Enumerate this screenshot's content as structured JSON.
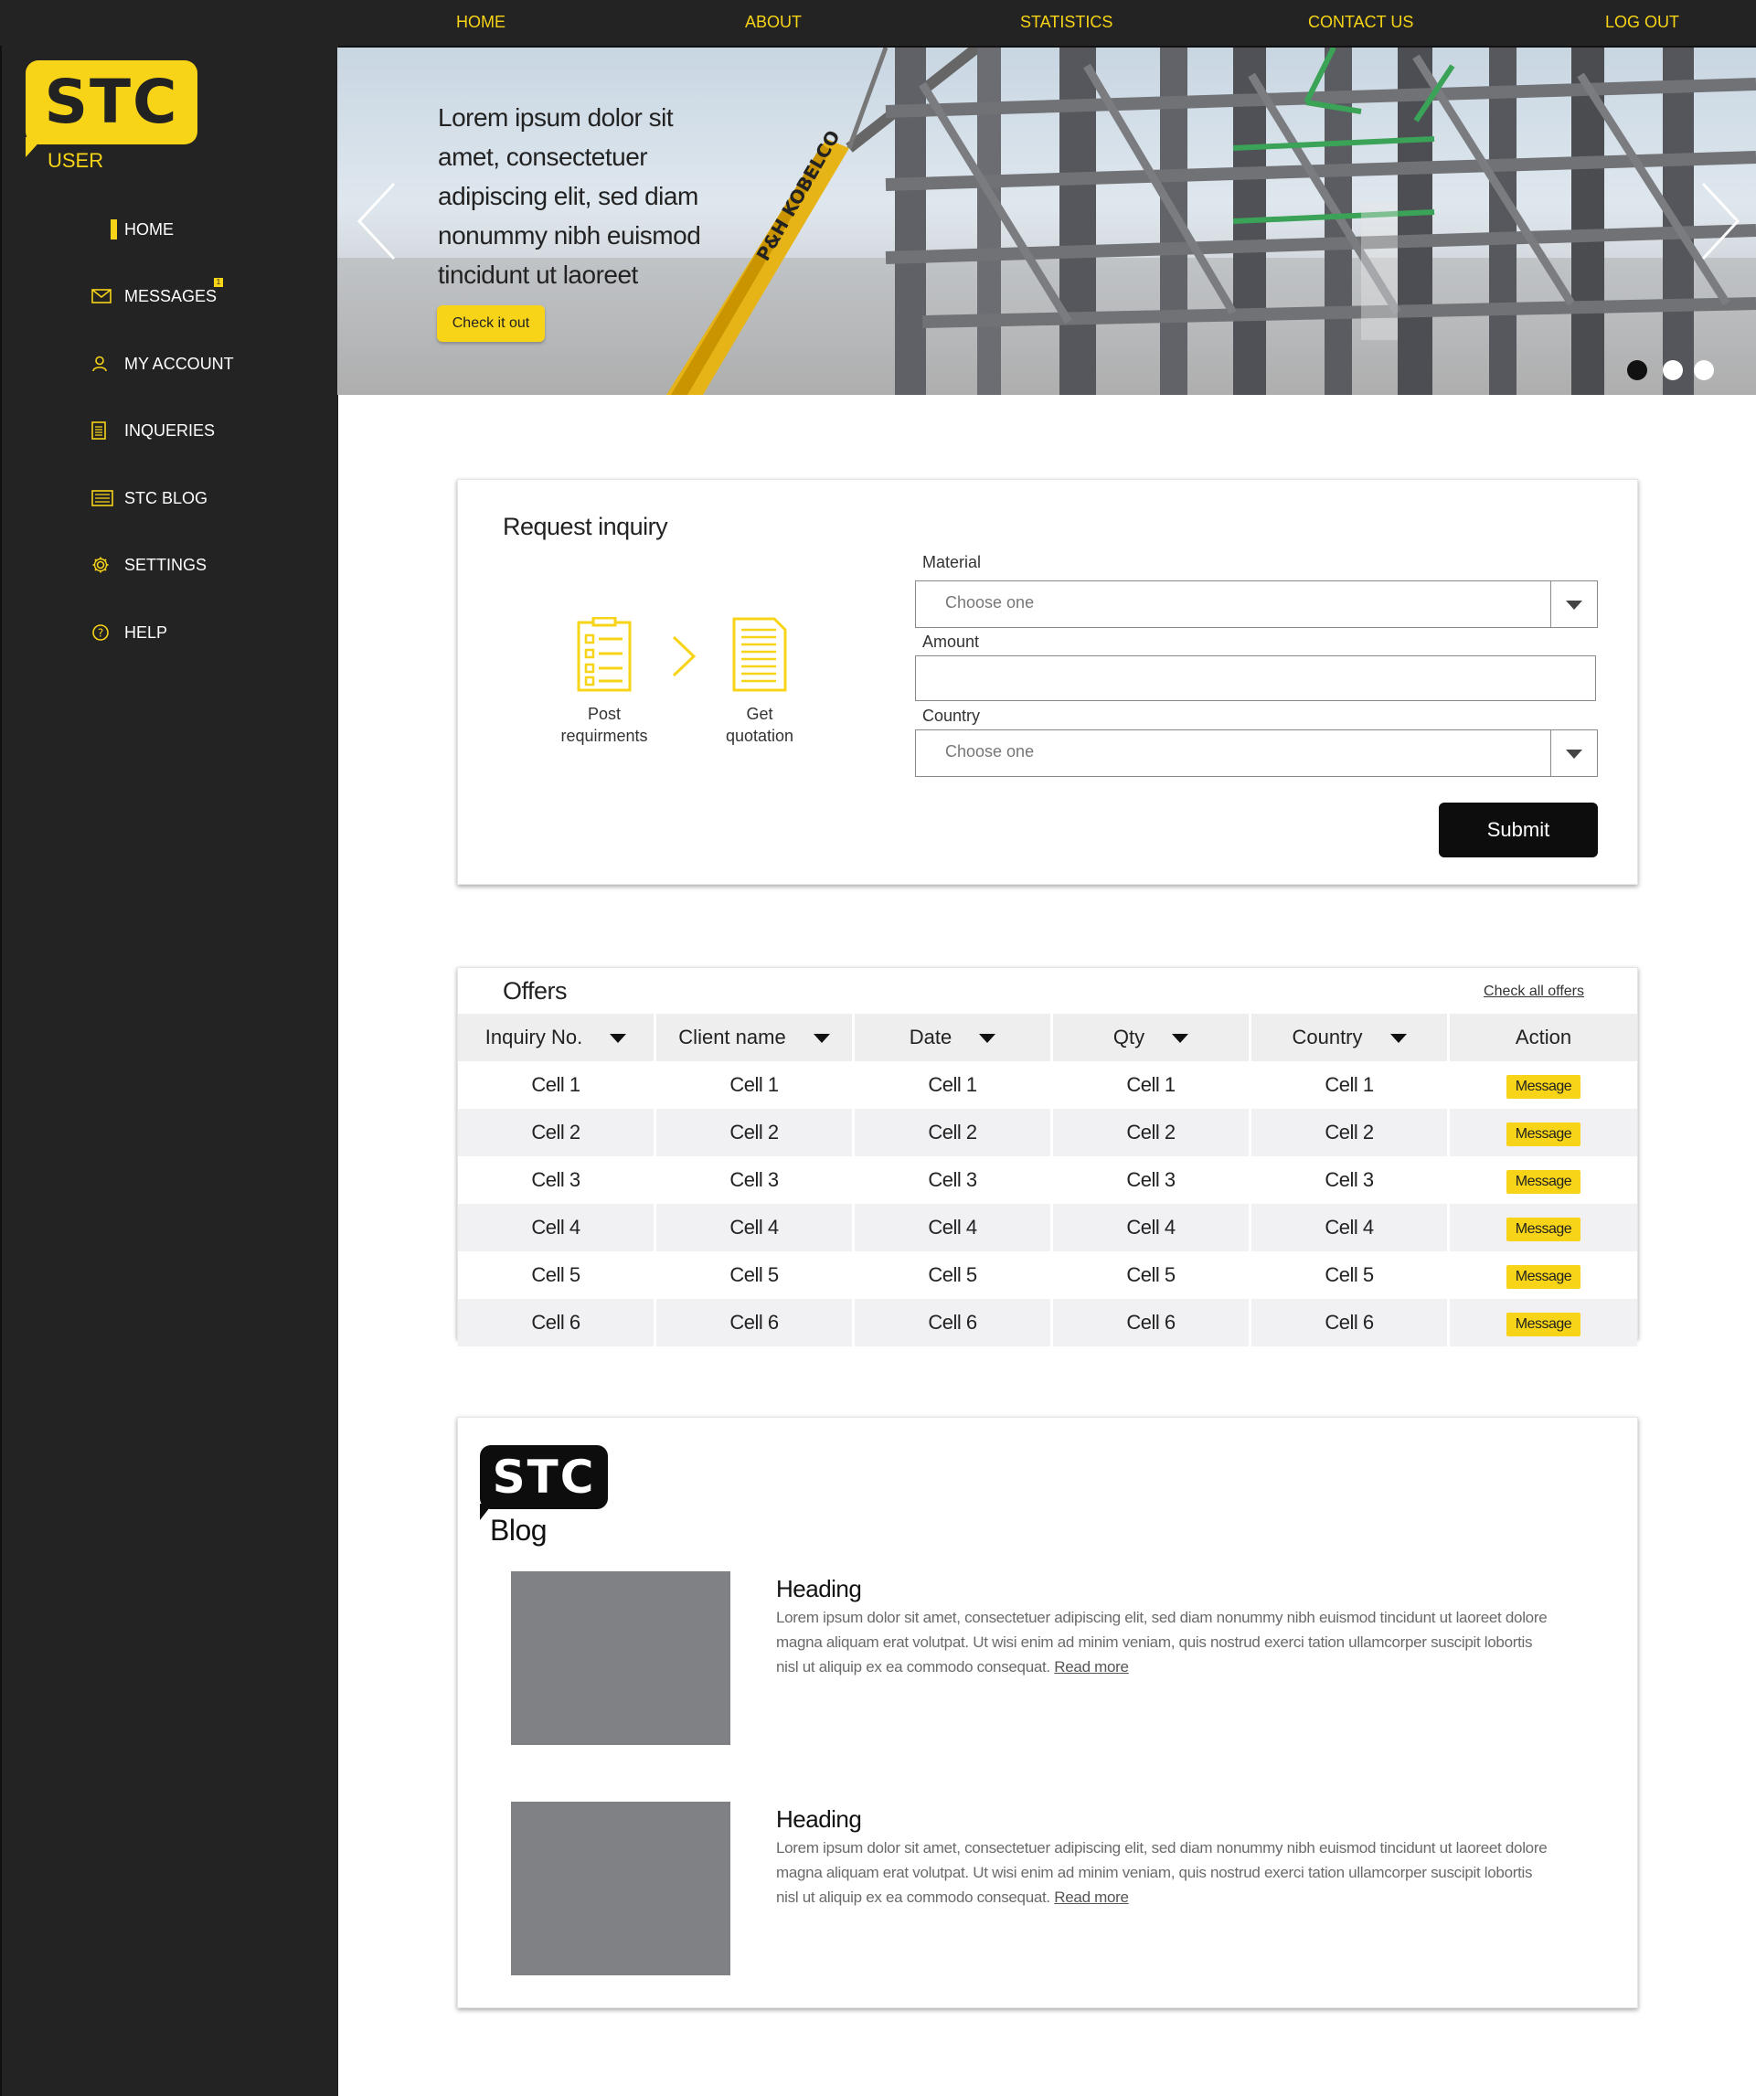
{
  "topnav": {
    "home": "HOME",
    "about": "ABOUT",
    "statistics": "STATISTICS",
    "contact": "CONTACT US",
    "logout": "LOG OUT"
  },
  "sidebar": {
    "logo": "STC",
    "user_label": "USER",
    "items": [
      {
        "label": "HOME",
        "icon": "home-active-marker"
      },
      {
        "label": "MESSAGES",
        "icon": "envelope-icon",
        "badge": "1"
      },
      {
        "label": "MY ACCOUNT",
        "icon": "user-icon"
      },
      {
        "label": "INQUERIES",
        "icon": "document-icon"
      },
      {
        "label": "STC BLOG",
        "icon": "newspaper-icon"
      },
      {
        "label": "SETTINGS",
        "icon": "gear-icon"
      },
      {
        "label": "HELP",
        "icon": "question-circle-icon"
      }
    ]
  },
  "hero": {
    "text": "Lorem ipsum dolor sit amet, consectetuer adipiscing elit, sed diam nonummy nibh euismod tincidunt ut laoreet",
    "cta": "Check it out",
    "crane_text": "P&H KOBELCO",
    "slides": 3,
    "active_slide": 1
  },
  "inquiry": {
    "title": "Request inquiry",
    "steps": [
      {
        "label_l1": "Post",
        "label_l2": "requirments"
      },
      {
        "label_l1": "Get",
        "label_l2": "quotation"
      }
    ],
    "material_label": "Material",
    "material_value": "Choose one",
    "amount_label": "Amount",
    "amount_value": "",
    "country_label": "Country",
    "country_value": "Choose one",
    "submit": "Submit"
  },
  "offers": {
    "title": "Offers",
    "check_all": "Check all offers",
    "columns": [
      "Inquiry No.",
      "Client name",
      "Date",
      "Qty",
      "Country",
      "Action"
    ],
    "rows": [
      [
        "Cell 1",
        "Cell 1",
        "Cell 1",
        "Cell 1",
        "Cell 1",
        "Message"
      ],
      [
        "Cell 2",
        "Cell 2",
        "Cell 2",
        "Cell 2",
        "Cell 2",
        "Message"
      ],
      [
        "Cell 3",
        "Cell 3",
        "Cell 3",
        "Cell 3",
        "Cell 3",
        "Message"
      ],
      [
        "Cell 4",
        "Cell 4",
        "Cell 4",
        "Cell 4",
        "Cell 4",
        "Message"
      ],
      [
        "Cell 5",
        "Cell 5",
        "Cell 5",
        "Cell 5",
        "Cell 5",
        "Message"
      ],
      [
        "Cell 6",
        "Cell 6",
        "Cell 6",
        "Cell 6",
        "Cell 6",
        "Message"
      ]
    ]
  },
  "blog": {
    "logo": "STC",
    "title": "Blog",
    "posts": [
      {
        "heading": "Heading",
        "body": "Lorem ipsum dolor sit amet, consectetuer adipiscing elit, sed diam nonummy nibh euismod tincidunt ut laoreet dolore magna aliquam erat volutpat. Ut wisi enim ad minim veniam, quis nostrud exerci tation ullamcorper suscipit lobortis nisl ut aliquip ex ea commodo consequat.",
        "read_more": "Read more"
      },
      {
        "heading": "Heading",
        "body": "Lorem ipsum dolor sit amet, consectetuer adipiscing elit, sed diam nonummy nibh euismod tincidunt ut laoreet dolore magna aliquam erat volutpat. Ut wisi enim ad minim veniam, quis nostrud exerci tation ullamcorper suscipit lobortis nisl ut aliquip ex ea commodo consequat.",
        "read_more": "Read more"
      }
    ]
  },
  "colors": {
    "accent": "#f7d417",
    "dark": "#232323",
    "placeholder_image": "#808184"
  }
}
